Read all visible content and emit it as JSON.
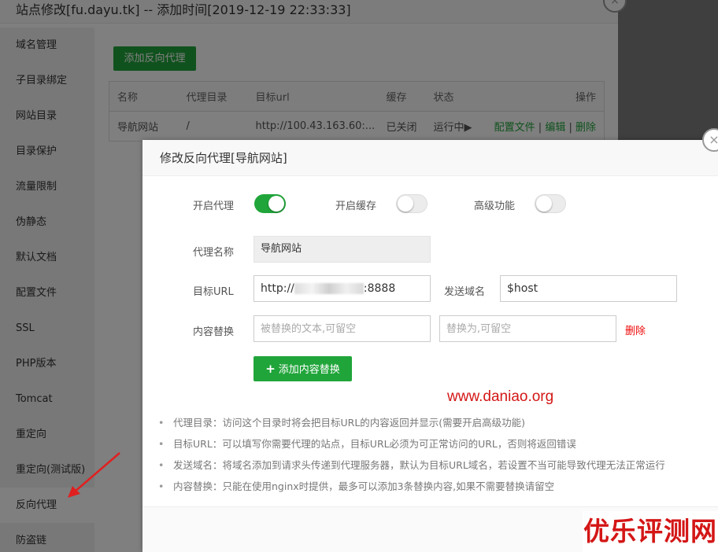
{
  "back_window": {
    "title": "站点修改[fu.dayu.tk] -- 添加时间[2019-12-19 22:33:33]",
    "close_icon": "×",
    "sidebar": {
      "items": [
        {
          "label": "域名管理"
        },
        {
          "label": "子目录绑定"
        },
        {
          "label": "网站目录"
        },
        {
          "label": "目录保护"
        },
        {
          "label": "流量限制"
        },
        {
          "label": "伪静态"
        },
        {
          "label": "默认文档"
        },
        {
          "label": "配置文件"
        },
        {
          "label": "SSL"
        },
        {
          "label": "PHP版本"
        },
        {
          "label": "Tomcat"
        },
        {
          "label": "重定向"
        },
        {
          "label": "重定向(测试版)"
        },
        {
          "label": "反向代理",
          "active": true
        },
        {
          "label": "防盗链"
        }
      ]
    },
    "add_proxy_button": "添加反向代理",
    "table": {
      "headers": [
        "名称",
        "代理目录",
        "目标url",
        "缓存",
        "状态",
        "操作"
      ],
      "rows": [
        {
          "name": "导航网站",
          "dir": "/",
          "url": "http://100.43.163.60:...",
          "cache": "已关闭",
          "status": "运行中▶",
          "actions": {
            "config": "配置文件",
            "sep1": " | ",
            "edit": "编辑",
            "sep2": " | ",
            "delete": "删除"
          }
        }
      ]
    }
  },
  "modal": {
    "title": "修改反向代理[导航网站]",
    "close_icon": "×",
    "toggles": [
      {
        "label": "开启代理",
        "on": true
      },
      {
        "label": "开启缓存",
        "on": false
      },
      {
        "label": "高级功能",
        "on": false
      }
    ],
    "proxy_name": {
      "label": "代理名称",
      "value": "导航网站"
    },
    "target_url": {
      "label": "目标URL",
      "prefix": "http://",
      "suffix": ":8888"
    },
    "send_domain": {
      "label": "发送域名",
      "value": "$host"
    },
    "content_replace": {
      "label": "内容替换",
      "from_placeholder": "被替换的文本,可留空",
      "to_placeholder": "替换为,可留空",
      "delete_label": "删除"
    },
    "add_replace_button": {
      "icon": "+",
      "label": "添加内容替换"
    },
    "watermark_url": "www.daniao.org",
    "tips": [
      "代理目录：访问这个目录时将会把目标URL的内容返回并显示(需要开启高级功能)",
      "目标URL：可以填写你需要代理的站点，目标URL必须为可正常访问的URL，否则将返回错误",
      "发送域名：将域名添加到请求头传递到代理服务器，默认为目标URL域名，若设置不当可能导致代理无法正常运行",
      "内容替换：只能在使用nginx时提供，最多可以添加3条替换内容,如果不需要替换请留空"
    ]
  },
  "watermark_brand": "优乐评测网",
  "colors": {
    "accent_green": "#20a53a",
    "danger_red": "#ef0808",
    "overlay": "rgba(0,0,0,0.5)",
    "annotation_red": "#e02020"
  }
}
